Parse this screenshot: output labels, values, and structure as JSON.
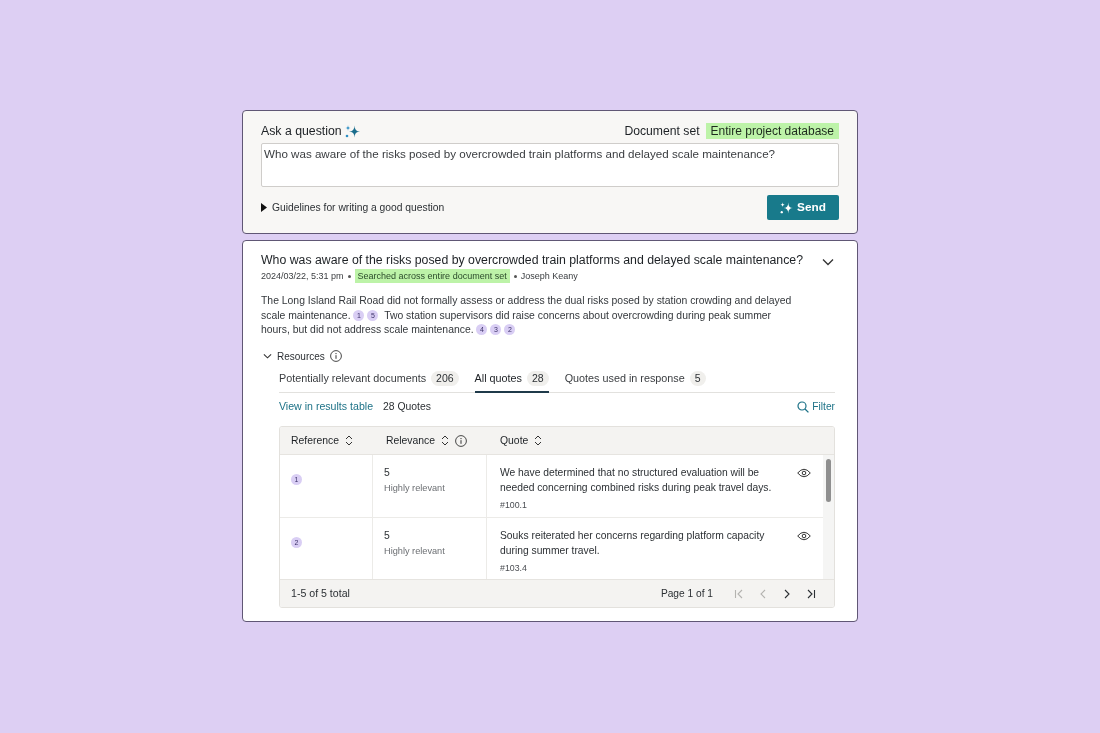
{
  "ask_panel": {
    "title": "Ask a question",
    "document_set_label": "Document set",
    "document_set_value": "Entire project database",
    "question": {
      "value": "Who was aware of the risks posed by overcrowded train platforms and delayed scale maintenance?"
    },
    "guidelines": {
      "label": "Guidelines for writing a good question",
      "expanded": false
    },
    "send_button": "Send"
  },
  "answer": {
    "question": "Who was aware of the risks posed by overcrowded train platforms and delayed scale maintenance?",
    "timestamp": "2024/03/22, 5:31 pm",
    "scope_tag": "Searched across entire document set",
    "author": "Joseph Keany",
    "response": [
      {
        "text": "The Long Island Rail Road did not formally assess or address the dual risks posed by station crowding and delayed scale maintenance.",
        "refs": [
          "1",
          "5"
        ]
      },
      {
        "text": "Two station supervisors did raise concerns about overcrowding during peak summer hours, but did not address scale maintenance.",
        "refs": [
          "4",
          "3",
          "2"
        ]
      }
    ]
  },
  "resources": {
    "label": "Resources",
    "expanded": true,
    "tabs": [
      {
        "label": "Potentially relevant documents",
        "count": "206",
        "selected": false
      },
      {
        "label": "All quotes",
        "count": "28",
        "selected": true
      },
      {
        "label": "Quotes used in response",
        "count": "5",
        "selected": false
      }
    ],
    "results_link": "View in results table",
    "quote_count": "28 Quotes",
    "filter_button": "Filter",
    "table": {
      "columns": [
        {
          "label": "Reference",
          "sortable": true
        },
        {
          "label": "Relevance",
          "sortable": true,
          "info": true
        },
        {
          "label": "Quote",
          "sortable": true
        }
      ],
      "rows": [
        {
          "reference": "1",
          "relevance": "5",
          "relevance_label": "Highly relevant",
          "quote": "We have determined that no structured evaluation will be needed concerning combined risks during peak travel days.",
          "quote_id": "#100.1"
        },
        {
          "reference": "2",
          "relevance": "5",
          "relevance_label": "Highly relevant",
          "quote": "Souks reiterated her concerns regarding platform capacity during summer travel.",
          "quote_id": "#103.4"
        }
      ],
      "footer": {
        "summary": "1-5 of 5 total",
        "page": "Page 1 of 1",
        "buttons": [
          {
            "kind": "first",
            "disabled": true
          },
          {
            "kind": "previous",
            "disabled": true
          },
          {
            "kind": "next",
            "disabled": false
          },
          {
            "kind": "last",
            "disabled": false
          }
        ]
      }
    }
  }
}
